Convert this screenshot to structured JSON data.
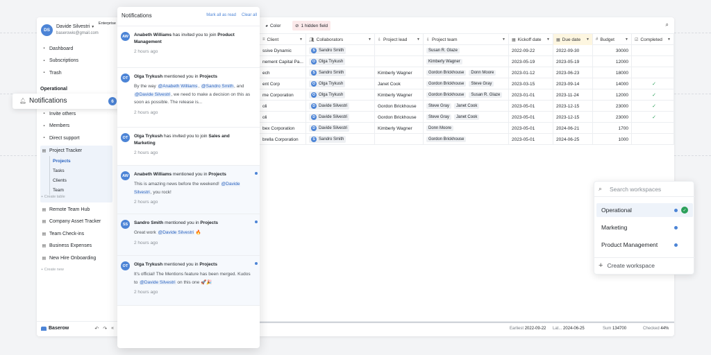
{
  "workspace": {
    "initials": "DS",
    "user_name": "Davide Silvestri",
    "email": "baserowio@gmail.com",
    "plan": "Enterprise"
  },
  "sidebar": {
    "top_items": [
      {
        "label": "Dashboard",
        "icon": "dashboard-icon"
      },
      {
        "label": "Subscriptions",
        "icon": "subscriptions-icon"
      },
      {
        "label": "Trash",
        "icon": "trash-icon"
      }
    ],
    "section_label": "Operational",
    "workspace_items": [
      {
        "label": "Invite others",
        "icon": "invite-icon"
      },
      {
        "label": "Members",
        "icon": "members-icon"
      },
      {
        "label": "Direct support",
        "icon": "support-icon"
      }
    ],
    "tracker": {
      "label": "Project Tracker",
      "tables": [
        "Projects",
        "Tasks",
        "Clients",
        "Team"
      ],
      "create_label": "+ Create table"
    },
    "databases": [
      "Remote Team Hub",
      "Company Asset Tracker",
      "Team Check-ins",
      "Business Expenses",
      "New Hire Onboarding"
    ],
    "create_new": "+ Create new",
    "brand": "Baserow"
  },
  "notification_pill": {
    "label": "Notifications",
    "count": "6"
  },
  "toolbar": {
    "color_label": "Color",
    "hidden_label": "1 hidden field"
  },
  "grid": {
    "headers": [
      "Client",
      "Collaborators",
      "Project lead",
      "Project team",
      "Kickoff date",
      "Due date",
      "Budget",
      "Completed"
    ],
    "rows": [
      {
        "client": "ssive Dynamic",
        "collab": "Sandro Smith",
        "lead": "",
        "team": [
          "Susan R. Glaze"
        ],
        "kickoff": "2022-09-22",
        "due": "2022-09-30",
        "budget": "30000",
        "done": false
      },
      {
        "client": "nement Capital Pa...",
        "collab": "Olga Trykush",
        "lead": "",
        "team": [
          "Kimberly Wagner"
        ],
        "kickoff": "2023-05-19",
        "due": "2023-05-19",
        "budget": "12000",
        "done": false
      },
      {
        "client": "ech",
        "collab": "Sandro Smith",
        "lead": "Kimberly Wagner",
        "team": [
          "Gordon Brickhouse",
          "Donn Moore"
        ],
        "kickoff": "2023-01-12",
        "due": "2023-06-23",
        "budget": "18000",
        "done": false
      },
      {
        "client": "ent Corp",
        "collab": "Olga Trykush",
        "lead": "Janet Cook",
        "team": [
          "Gordon Brickhouse",
          "Steve Gray"
        ],
        "kickoff": "2023-03-15",
        "due": "2023-09-14",
        "budget": "14000",
        "done": true
      },
      {
        "client": "me Corporation",
        "collab": "Olga Trykush",
        "lead": "Kimberly Wagner",
        "team": [
          "Gordon Brickhouse",
          "Susan R. Glaze"
        ],
        "kickoff": "2023-01-01",
        "due": "2023-11-24",
        "budget": "12000",
        "done": true
      },
      {
        "client": "oli",
        "collab": "Davide Silvestri",
        "lead": "Gordon Brickhouse",
        "team": [
          "Steve Gray",
          "Janet Cook"
        ],
        "kickoff": "2023-05-01",
        "due": "2023-12-15",
        "budget": "23000",
        "done": true
      },
      {
        "client": "oli",
        "collab": "Davide Silvestri",
        "lead": "Gordon Brickhouse",
        "team": [
          "Steve Gray",
          "Janet Cook"
        ],
        "kickoff": "2023-05-01",
        "due": "2023-12-15",
        "budget": "23000",
        "done": true
      },
      {
        "client": "bex Corporation",
        "collab": "Davide Silvestri",
        "lead": "Kimberly Wagner",
        "team": [
          "Donn Moore"
        ],
        "kickoff": "2023-05-01",
        "due": "2024-06-21",
        "budget": "1700",
        "done": false
      },
      {
        "client": "brella Corporation",
        "collab": "Sandro Smith",
        "lead": "",
        "team": [
          "Gordon Brickhouse"
        ],
        "kickoff": "2023-05-01",
        "due": "2024-06-25",
        "budget": "1000",
        "done": false
      }
    ]
  },
  "status_bar": {
    "earliest_label": "Earliest",
    "earliest_value": "2022-09-22",
    "latest_label": "Lat...",
    "latest_value": "2024-06-25",
    "sum_label": "Sum",
    "sum_value": "134700",
    "checked_label": "Checked",
    "checked_value": "44%"
  },
  "notifications": {
    "title": "Notifications",
    "mark_all": "Mark all as read",
    "clear_all": "Clear all",
    "items": [
      {
        "initials": "AW",
        "actor": "Anabeth Williams",
        "action": " has invited you to join ",
        "target": "Product Management",
        "body": "",
        "time": "2 hours ago",
        "unread": false
      },
      {
        "initials": "OT",
        "actor": "Olga Trykush",
        "action": " mentioned you in ",
        "target": "Projects",
        "body_parts": [
          "By the way ",
          "@Anabeth Williams",
          ", ",
          "@Sandro Smith",
          ", and ",
          "@Davide Silvestri",
          ", we need to make a decision on this as soon as possible. The release is..."
        ],
        "time": "2 hours ago",
        "unread": false
      },
      {
        "initials": "OT",
        "actor": "Olga Trykush",
        "action": " has invited you to join ",
        "target": "Sales and Marketing",
        "body": "",
        "time": "2 hours ago",
        "unread": false
      },
      {
        "initials": "AW",
        "actor": "Anabeth Williams",
        "action": " mentioned you in ",
        "target": "Projects",
        "body_parts": [
          "This is amazing news before the weekend! ",
          "@Davide Silvestri",
          ", you rock!"
        ],
        "time": "2 hours ago",
        "unread": true
      },
      {
        "initials": "SS",
        "actor": "Sandro Smith",
        "action": " mentioned you in ",
        "target": "Projects",
        "body_parts": [
          "Great work ",
          "@Davide Silvestri",
          " 🔥"
        ],
        "time": "2 hours ago",
        "unread": true
      },
      {
        "initials": "OT",
        "actor": "Olga Trykush",
        "action": " mentioned you in ",
        "target": "Projects",
        "body_parts": [
          "It's official! The Mentions feature has been merged. Kudos to ",
          "@Davide Silvestri",
          " on this one 🚀🎉"
        ],
        "time": "2 hours ago",
        "unread": true
      }
    ]
  },
  "workspace_switcher": {
    "search_placeholder": "Search workspaces",
    "items": [
      "Operational",
      "Marketing",
      "Product Management"
    ],
    "create_label": "Create workspace"
  },
  "colors": {
    "accent": "#4c84d6",
    "success": "#2ca05a"
  }
}
